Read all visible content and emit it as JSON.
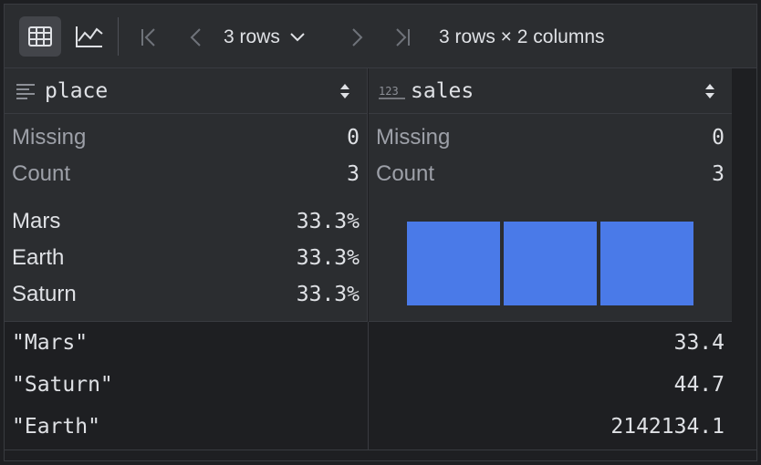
{
  "toolbar": {
    "icons": [
      "table-view-icon",
      "chart-view-icon",
      "first-page-icon",
      "previous-page-icon",
      "next-page-icon",
      "last-page-icon"
    ],
    "rows_selector": "3 rows",
    "summary": "3 rows × 2 columns"
  },
  "columns": [
    {
      "name": "place",
      "type_icon": "text-type-icon",
      "stats": {
        "missing_label": "Missing",
        "missing_value": "0",
        "count_label": "Count",
        "count_value": "3"
      },
      "categories": [
        {
          "label": "Mars",
          "percent": "33.3%"
        },
        {
          "label": "Earth",
          "percent": "33.3%"
        },
        {
          "label": "Saturn",
          "percent": "33.3%"
        }
      ]
    },
    {
      "name": "sales",
      "type_icon_text": "123",
      "stats": {
        "missing_label": "Missing",
        "missing_value": "0",
        "count_label": "Count",
        "count_value": "3"
      },
      "histogram": {
        "bins": 3,
        "counts": [
          1,
          1,
          1
        ],
        "color": "#4a7ae8"
      }
    }
  ],
  "rows": [
    {
      "place": "\"Mars\"",
      "sales": "33.4"
    },
    {
      "place": "\"Saturn\"",
      "sales": "44.7"
    },
    {
      "place": "\"Earth\"",
      "sales": "2142134.1"
    }
  ],
  "colors": {
    "accent": "#4a7ae8",
    "background": "#1e1f22",
    "panel": "#2b2d30"
  }
}
